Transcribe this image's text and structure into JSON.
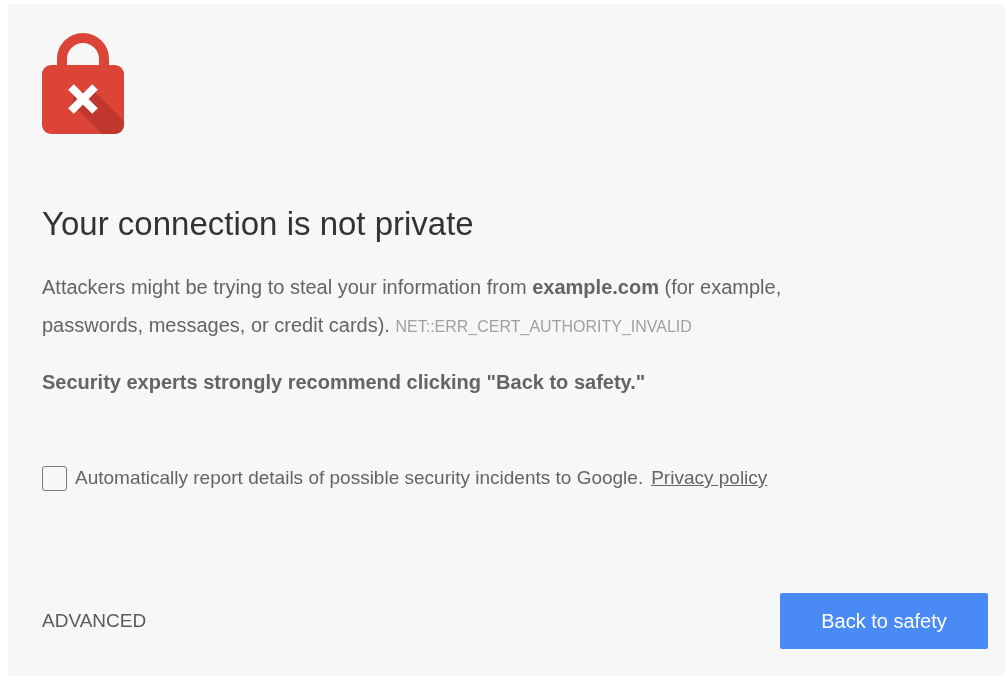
{
  "heading": "Your connection is not private",
  "message": {
    "text": "Attackers might be trying to steal your information from **example.com** (for example, passwords, messages, or credit cards).",
    "error_code": "NET::ERR_CERT_AUTHORITY_INVALID"
  },
  "recommendation": "Security experts strongly recommend clicking \"Back to safety.\"",
  "report_option": {
    "label": "Automatically report details of possible security incidents to Google.",
    "link": "Privacy policy",
    "checked": false
  },
  "buttons": [
    {
      "kind": "link",
      "label": "ADVANCED"
    },
    {
      "kind": "primary",
      "label": "Back to safety"
    }
  ]
}
